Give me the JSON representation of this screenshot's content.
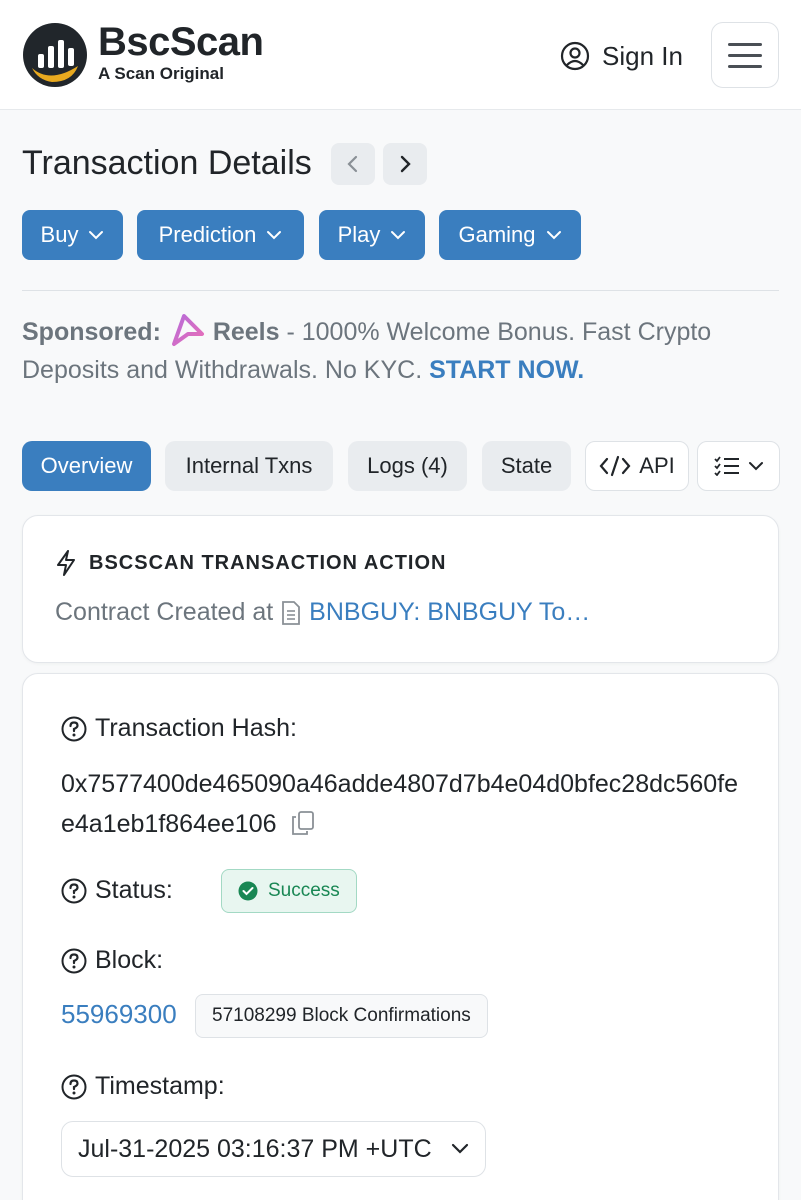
{
  "header": {
    "brand": "BscScan",
    "tagline": "A Scan Original",
    "sign_in": "Sign In"
  },
  "title_row": {
    "title": "Transaction Details"
  },
  "menus": [
    {
      "label": "Buy"
    },
    {
      "label": "Prediction"
    },
    {
      "label": "Play"
    },
    {
      "label": "Gaming"
    }
  ],
  "sponsored": {
    "label": "Sponsored:",
    "brand": "Reels",
    "text": " - 1000% Welcome Bonus. Fast Crypto Deposits and Withdrawals. No KYC. ",
    "cta": "START NOW."
  },
  "tabs": [
    {
      "label": "Overview",
      "active": true
    },
    {
      "label": "Internal Txns"
    },
    {
      "label": "Logs (4)"
    },
    {
      "label": "State"
    },
    {
      "label": "API"
    }
  ],
  "action": {
    "heading": "BSCSCAN TRANSACTION ACTION",
    "prefix": "Contract Created at",
    "link": "BNBGUY: BNBGUY To…"
  },
  "details": {
    "hash_label": "Transaction Hash:",
    "hash_value": "0x7577400de465090a46adde4807d7b4e04d0bfec28dc560fee4a1eb1f864ee106",
    "status_label": "Status:",
    "status_value": "Success",
    "block_label": "Block:",
    "block_value": "55969300",
    "confirmations": "57108299 Block Confirmations",
    "timestamp_label": "Timestamp:",
    "timestamp_value": "Jul-31-2025 03:16:37 PM +UTC"
  },
  "colors": {
    "primary": "#3a7ebf",
    "success": "#198754",
    "logo_gold": "#e8a91f"
  }
}
